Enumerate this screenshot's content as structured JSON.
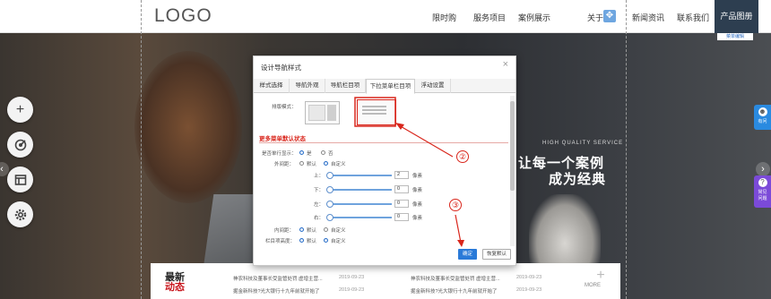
{
  "header": {
    "logo": "LOGO",
    "nav": [
      "限时购",
      "服务项目",
      "案例展示",
      "关于",
      "新闻资讯",
      "联系我们"
    ],
    "active_nav": "产品图册",
    "active_sub": "菜单编辑"
  },
  "hero": {
    "tagline_small": "HIGH QUALITY SERVICE",
    "tagline_line1": "让每一个案例",
    "tagline_line2": "成为经典"
  },
  "left_tools": [
    "plus-icon",
    "target-icon",
    "layout-icon",
    "gear-icon"
  ],
  "right_widgets": {
    "w1": "有问",
    "w2_line1": "常见",
    "w2_line2": "问题"
  },
  "dialog": {
    "title": "设计导航样式",
    "close": "×",
    "tabs": [
      "样式选择",
      "导航外观",
      "导航栏目项",
      "下拉菜单栏目项",
      "浮动设置"
    ],
    "active_tab": 3,
    "layout_label": "排版模式：",
    "section_title": "更多菜单默认状态",
    "row_single": {
      "label": "是否单行显示：",
      "opt_yes": "是",
      "opt_no": "否"
    },
    "row_margin": {
      "label": "外间距：",
      "opt_default": "默认",
      "opt_custom": "自定义"
    },
    "sliders": [
      {
        "label": "上：",
        "value": "2",
        "unit": "像素"
      },
      {
        "label": "下：",
        "value": "0",
        "unit": "像素"
      },
      {
        "label": "左：",
        "value": "0",
        "unit": "像素"
      },
      {
        "label": "右：",
        "value": "0",
        "unit": "像素"
      }
    ],
    "row_padding": {
      "label": "内间距：",
      "opt_default": "默认",
      "opt_custom": "自定义"
    },
    "row_height": {
      "label": "栏目项高度：",
      "opt_default": "默认",
      "opt_custom": "自定义"
    },
    "btn_ok": "确定",
    "btn_reset": "恢复默认"
  },
  "annotations": {
    "n2": "②",
    "n3": "③"
  },
  "news": {
    "title_line1": "最新",
    "title_line2": "动态",
    "items": [
      {
        "text": "神农科技及董事长受监管处罚 虚增主营...",
        "date": "2019-09-23"
      },
      {
        "text": "神农科技及董事长受监管处罚 虚增主营...",
        "date": "2019-09-23"
      },
      {
        "text": "掘金新科技?光大银行十九年前就开始了",
        "date": "2019-09-23"
      },
      {
        "text": "掘金新科技?光大银行十九年前就开始了",
        "date": "2019-09-23"
      }
    ],
    "more": "MORE"
  },
  "colors": {
    "accent_red": "#d9261c",
    "nav_active_bg": "#2d3e50",
    "ok_button": "#2a7ad8"
  }
}
